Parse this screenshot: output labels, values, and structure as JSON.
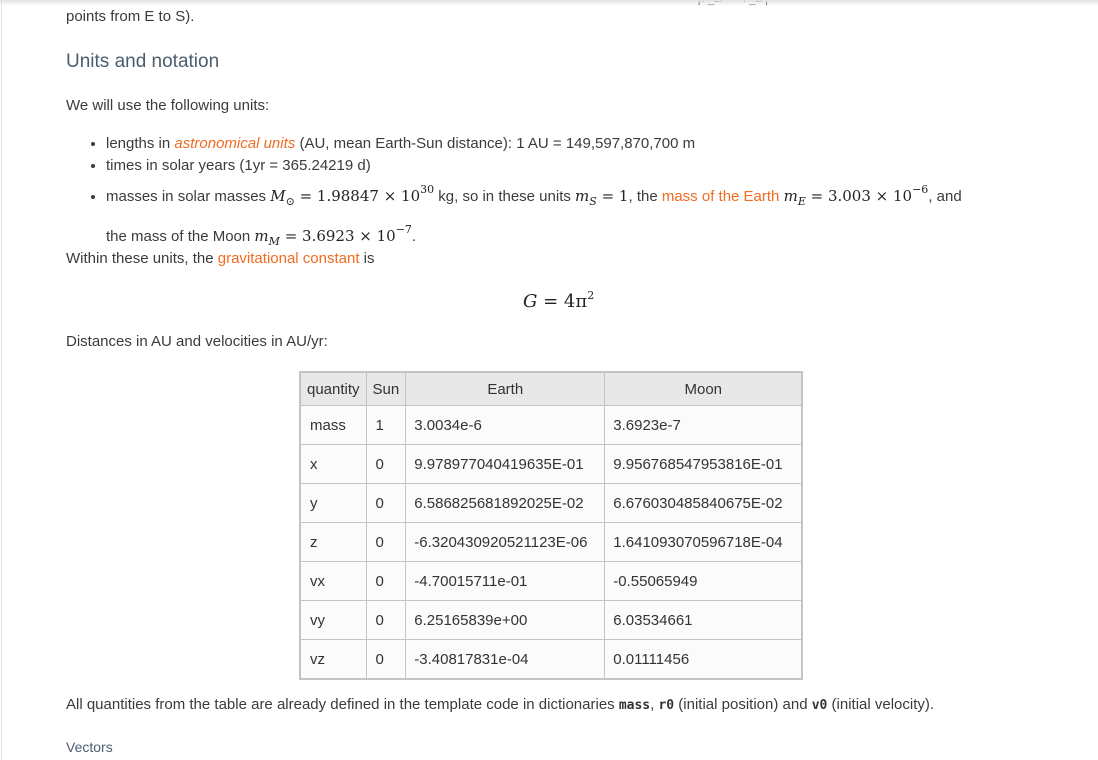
{
  "top_fragment": "|r_E − r_S|",
  "intro_tail": "points from E to S).",
  "section_heading": "Units and notation",
  "units_intro": "We will use the following units:",
  "units_list": {
    "lengths": {
      "pre": "lengths in ",
      "link": "astronomical units",
      "post": " (AU, mean Earth-Sun distance): 1 AU = 149,597,870,700 m"
    },
    "times": {
      "text": "times in solar years (1yr = 365.24219 d)"
    },
    "masses": {
      "pre": "masses in solar masses ",
      "math_msun": "M",
      "math_msun_sub": "⊙",
      "math_msun_val": " = 1.98847 × 10",
      "math_msun_exp": "30",
      "mid": " kg, so in these units ",
      "math_ms": "m",
      "math_ms_sub": "S",
      "math_ms_val": " = 1",
      "comma": ", the ",
      "link": "mass of the Earth",
      "math_me": "m",
      "math_me_sub": "E",
      "math_me_val": " = 3.003 × 10",
      "math_me_exp": "−6",
      "and": ", and",
      "moon_pre": "the mass of the Moon ",
      "math_mm": "m",
      "math_mm_sub": "M",
      "math_mm_val": " = 3.6923 × 10",
      "math_mm_exp": "−7",
      "end": "."
    }
  },
  "gravity": {
    "pre": "Within these units, the ",
    "link": "gravitational constant",
    "post": " is",
    "eq_lhs": "G",
    "eq_rhs": " = 4π",
    "eq_exp": "2"
  },
  "distances_note": "Distances in AU and velocities in AU/yr:",
  "table": {
    "headers": [
      "quantity",
      "Sun",
      "Earth",
      "Moon"
    ],
    "rows": [
      [
        "mass",
        "1",
        "3.0034e-6",
        "3.6923e-7"
      ],
      [
        "x",
        "0",
        "9.978977040419635E-01",
        "9.956768547953816E-01"
      ],
      [
        "y",
        "0",
        "6.586825681892025E-02",
        "6.676030485840675E-02"
      ],
      [
        "z",
        "0",
        "-6.320430920521123E-06",
        "1.641093070596718E-04"
      ],
      [
        "vx",
        "0",
        "-4.70015711e-01",
        "-0.55065949"
      ],
      [
        "vy",
        "0",
        "6.25165839e+00",
        "6.03534661"
      ],
      [
        "vz",
        "0",
        "-3.40817831e-04",
        "0.01111456"
      ]
    ]
  },
  "footnote": {
    "pre": "All quantities from the table are already defined in the template code in dictionaries ",
    "code1": "mass",
    "sep1": ", ",
    "code2": "r0",
    "mid": " (initial position) and ",
    "code3": "v0",
    "post": " (initial velocity)."
  },
  "next_heading": "Vectors",
  "colors": {
    "link": "#f26b21",
    "heading": "#4c5d6e",
    "table_header_bg": "#e8e8e8"
  }
}
